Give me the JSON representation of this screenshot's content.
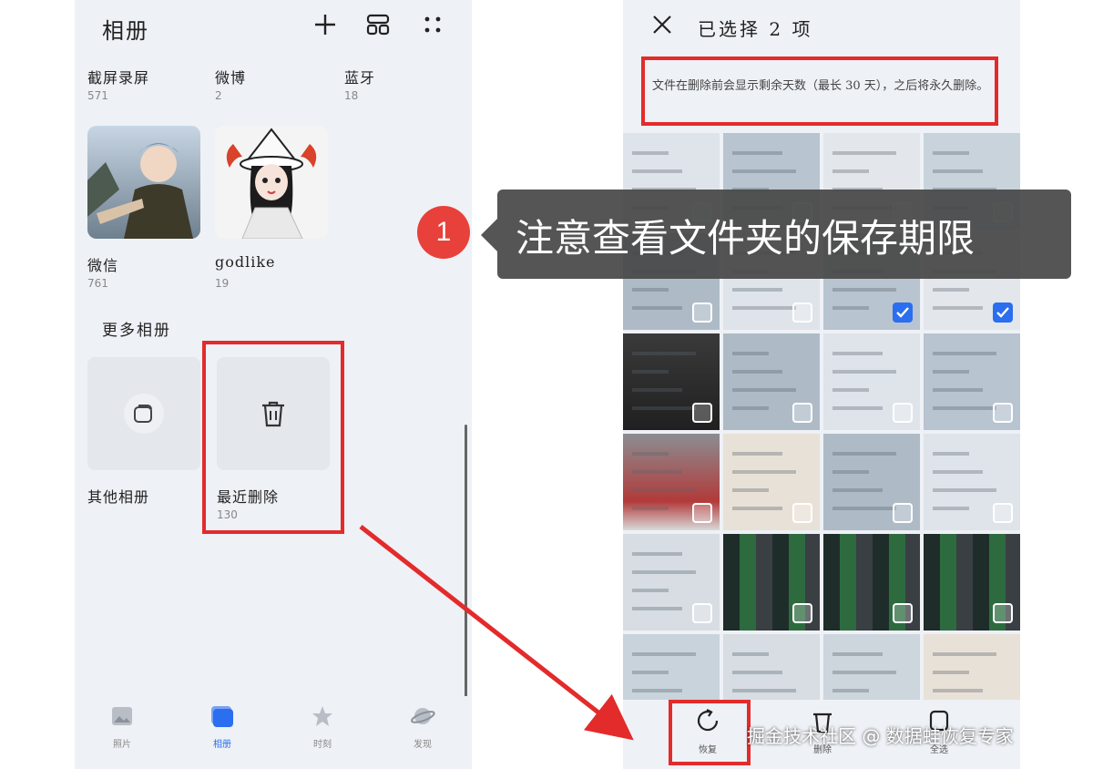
{
  "left_screen": {
    "header": {
      "title": "相册",
      "add_icon": "plus-icon",
      "layout_icon": "grid-layout-icon",
      "more_icon": "more-dots-icon"
    },
    "albums_top": [
      {
        "name": "截屏录屏",
        "count": "571"
      },
      {
        "name": "微博",
        "count": "2"
      },
      {
        "name": "蓝牙",
        "count": "18"
      }
    ],
    "albums_mid": [
      {
        "name": "微信",
        "count": "761"
      },
      {
        "name": "godlike",
        "count": "19"
      }
    ],
    "more_section": {
      "title": "更多相册"
    },
    "more_albums": [
      {
        "name": "其他相册",
        "count": "",
        "icon": "albums-icon"
      },
      {
        "name": "最近删除",
        "count": "130",
        "icon": "trash-icon"
      }
    ],
    "bottom_nav": [
      {
        "label": "照片",
        "icon": "photo-icon"
      },
      {
        "label": "相册",
        "icon": "album-icon",
        "active": true
      },
      {
        "label": "时刻",
        "icon": "star-icon"
      },
      {
        "label": "发现",
        "icon": "planet-icon"
      }
    ]
  },
  "right_screen": {
    "header": {
      "title": "已选择 2 项",
      "close_icon": "close-icon"
    },
    "notice": "文件在删除前会显示剩余天数（最长 30 天），之后将永久删除。",
    "grid": {
      "columns": 4,
      "checked_cells": [
        6,
        7
      ]
    },
    "bottom_actions": [
      {
        "label": "恢复",
        "icon": "restore-icon"
      },
      {
        "label": "删除",
        "icon": "delete-icon"
      },
      {
        "label": "全选",
        "icon": "select-all-icon"
      }
    ]
  },
  "annotation": {
    "badge": "1",
    "callout": "注意查看文件夹的保存期限"
  },
  "watermark": "掘金技术社区 @ 数据蛙恢复专家",
  "colors": {
    "highlight_red": "#e32b2b",
    "accent_blue": "#2b6ef0",
    "badge_red": "#e8403a"
  }
}
